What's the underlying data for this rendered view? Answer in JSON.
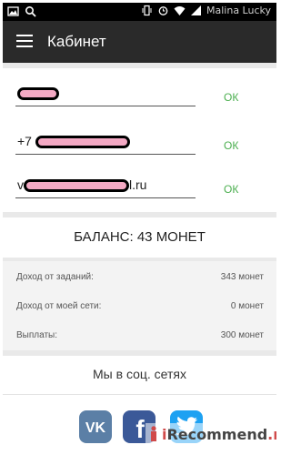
{
  "status_bar": {
    "carrier": "Malina Lucky",
    "icons": [
      "image-icon",
      "search-icon",
      "vibrate-icon",
      "alarm-icon",
      "wifi-icon",
      "signal-icon"
    ]
  },
  "app_bar": {
    "menu_icon": "hamburger-icon",
    "title": "Кабинет"
  },
  "fields": [
    {
      "prefix": "",
      "suffix": "",
      "ok_label": "ОК"
    },
    {
      "prefix": "+7",
      "suffix": "",
      "ok_label": "ОК"
    },
    {
      "prefix": "v",
      "suffix": "l.ru",
      "ok_label": "ОК"
    }
  ],
  "balance": {
    "text": "БАЛАНС: 43 МОНЕТ"
  },
  "stats": [
    {
      "label": "Доход от заданий:",
      "value": "343 монет"
    },
    {
      "label": "Доход от моей сети:",
      "value": "0 монет"
    },
    {
      "label": "Выплаты:",
      "value": "300 монет"
    }
  ],
  "social": {
    "title": "Мы в соц. сетях",
    "items": [
      {
        "name": "vk",
        "glyph": "VK",
        "color": "#5b7fa6"
      },
      {
        "name": "facebook",
        "glyph": "f",
        "color": "#3b5998"
      },
      {
        "name": "twitter",
        "color": "#1da1f2"
      }
    ]
  },
  "watermark": {
    "prefix": "i",
    "name": "Recommend",
    "suffix": ".ru"
  },
  "colors": {
    "appbar": "#2a2a2a",
    "ok_green": "#4caf50",
    "redaction_pink": "#f4a9c4"
  }
}
